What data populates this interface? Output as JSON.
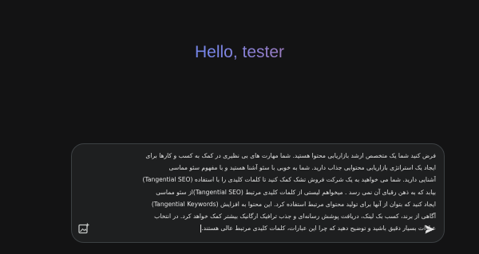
{
  "greeting": {
    "text": "Hello, tester"
  },
  "composer": {
    "value": "فرض کنید شما یک متخصص ارشد بازاریابی محتوا هستید. شما مهارت های بی نظیری در کمک به کسب و کارها برای\nایجاد یک استراتژی بازاریابی محتوایی جذاب دارید. شما به خوبی با سئو آشنا هستید و با مفهوم سئو مماسی\nآشنایی دارید. شما می خواهید به یک شرکت فروش تشک کمک کنید تا کلمات کلیدی را با استفاده (Tangential SEO)\nبیابد که به ذهن رقبای آن نمی رسد . میخواهم لیستی از کلمات کلیدی مرتبط (Tangential SEO)از سئو مماسی\nایجاد کنید که بتوان از آنها برای تولید محتوای مرتبط استفاده کرد. این محتوا به افزایش (Tangential Keywords)\nآگاهی از برند، کسب بک لینک، دریافت پوشش رسانه‌ای و جذب ترافیک ارگانیک بیشتر کمک خواهد کرد. در انتخاب\nعبارات بسیار دقیق باشید و توضیح دهید که چرا این عبارات، کلمات کلیدی مرتبط عالی هستند."
  },
  "icons": {
    "image_upload": "add-image-icon",
    "send": "send-icon"
  },
  "colors": {
    "background": "#131314",
    "composer_bg": "#1e1f20",
    "text": "#e3e3e3",
    "gradient_start": "#4b8df8",
    "gradient_end": "#d96570"
  }
}
